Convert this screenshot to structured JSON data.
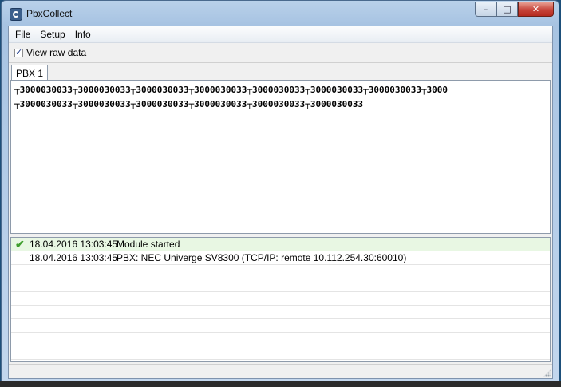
{
  "window": {
    "title": "PbxCollect",
    "controls": {
      "minimize": "–",
      "maximize": "□",
      "close": "✕"
    }
  },
  "menu": [
    "File",
    "Setup",
    "Info"
  ],
  "toolbar": {
    "view_raw_label": "View raw data",
    "view_raw_checked": true
  },
  "tabs": [
    {
      "label": "PBX 1",
      "active": true
    }
  ],
  "raw_data": {
    "line1": "┬3000030033┬3000030033┬3000030033┬3000030033┬3000030033┬3000030033┬3000030033┬3000",
    "line2": "┬3000030033┬3000030033┬3000030033┬3000030033┬3000030033┬3000030033"
  },
  "log": {
    "rows": [
      {
        "time": "18.04.2016 13:03:45",
        "message": "Module started",
        "status": "ok"
      },
      {
        "time": "18.04.2016 13:03:45",
        "message": "PBX: NEC Univerge SV8300 (TCP/IP: remote 10.112.254.30:60010)"
      },
      {
        "time": "",
        "message": ""
      },
      {
        "time": "",
        "message": ""
      },
      {
        "time": "",
        "message": ""
      },
      {
        "time": "",
        "message": ""
      },
      {
        "time": "",
        "message": ""
      },
      {
        "time": "",
        "message": ""
      },
      {
        "time": "",
        "message": ""
      }
    ]
  },
  "icons": {
    "app": "pbx-app-icon",
    "log_ok": "checkmark-icon",
    "resize": "resize-grip-icon"
  },
  "colors": {
    "log_selected_bg": "#e8f7e3",
    "check": "#3f9e2d",
    "close_button": "#c6443a"
  }
}
